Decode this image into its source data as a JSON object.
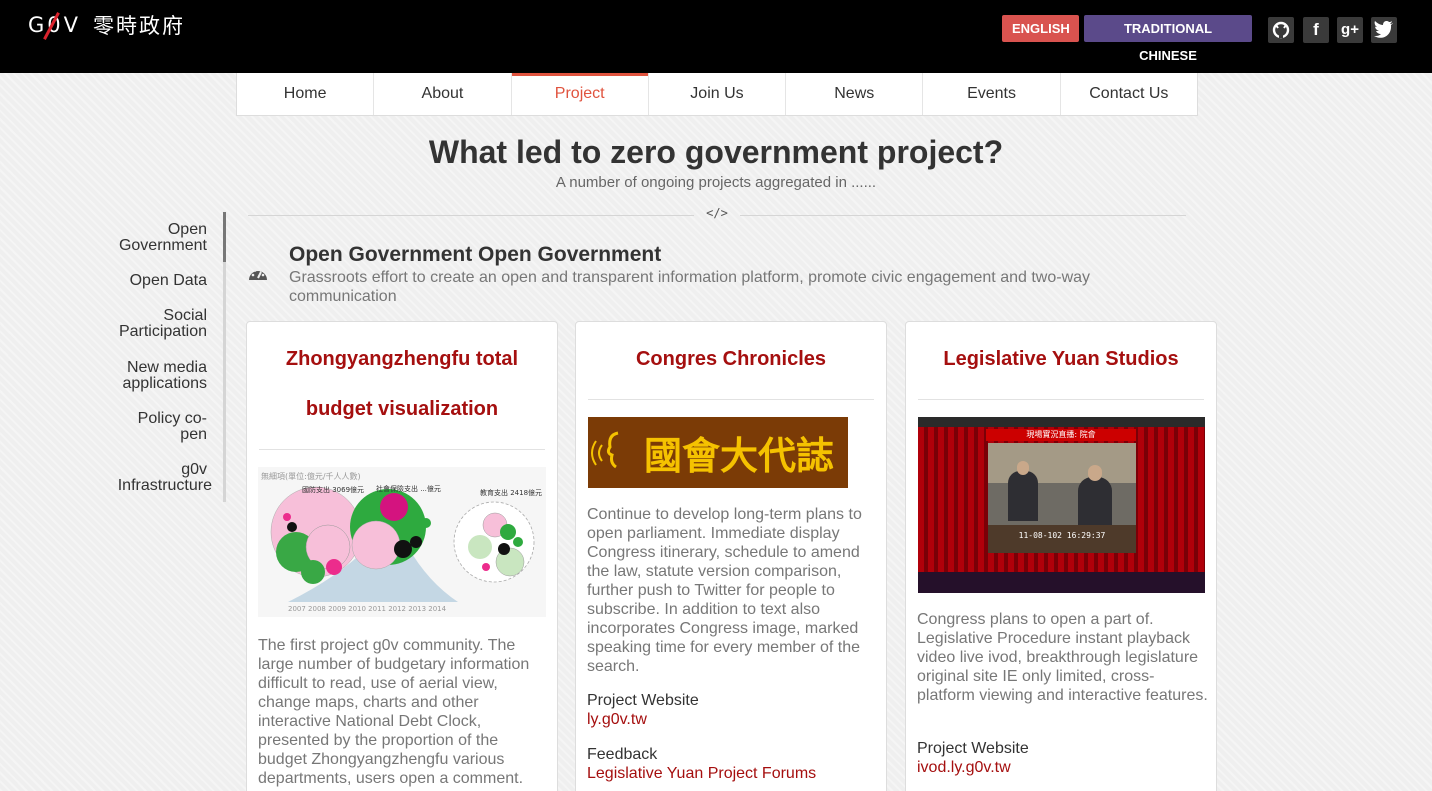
{
  "header": {
    "logo_text": "G0V",
    "logo_cn": "零時政府",
    "lang_en": "ENGLISH",
    "lang_zh": "TRADITIONAL CHINESE",
    "social": [
      "github-icon",
      "facebook-icon",
      "google-plus-icon",
      "twitter-icon"
    ]
  },
  "nav": {
    "items": [
      "Home",
      "About",
      "Project",
      "Join Us",
      "News",
      "Events",
      "Contact Us"
    ],
    "active": "Project"
  },
  "page": {
    "title": "What led to zero government project?",
    "subtitle": "A number of ongoing projects aggregated in ......",
    "divider_glyph": "</>"
  },
  "sidebar": {
    "items": [
      {
        "line1": "Open",
        "line2": "Government"
      },
      {
        "line1": "Open Data",
        "line2": ""
      },
      {
        "line1": "Social",
        "line2": "Participation"
      },
      {
        "line1": "New media",
        "line2": "applications"
      },
      {
        "line1": "Policy co-",
        "line2": "pen"
      },
      {
        "line1": "g0v",
        "line2": "Infrastructure"
      }
    ]
  },
  "section": {
    "title": "Open Government Open Government",
    "description": "Grassroots effort to create an open and transparent information platform, promote civic engagement and two-way communication",
    "icon": "dashboard-icon"
  },
  "cards": [
    {
      "title_line1": "Zhongyangzhengfu total",
      "title_line2": "budget visualization",
      "image_title": "無細項(單位:億元/千人人數)",
      "image_labels": [
        "國防支出 3069億元",
        "社會保險支出 ...億元",
        "教育支出 2418億元"
      ],
      "image_years": "2007 2008 2009 2010 2011 2012 2013 2014",
      "text": "The first project g0v community. The large number of budgetary information difficult to read, use of aerial view, change maps, charts and other interactive National Debt Clock, presented by the proportion of the budget Zhongyangzhengfu various departments, users open a comment."
    },
    {
      "title": "Congres Chronicles",
      "banner_text": "國會大代誌",
      "text": "Continue to develop long-term plans to open parliament. Immediate display Congress itinerary, schedule to amend the law, statute version comparison, further push to Twitter for people to subscribe. In addition to text also incorporates Congress image, marked speaking time for every member of the search.",
      "website_label": "Project Website",
      "website_link": "ly.g0v.tw",
      "feedback_label": "Feedback",
      "feedback_link": "Legislative Yuan Project Forums"
    },
    {
      "title": "Legislative Yuan Studios",
      "video_banner": "現場實況直播: 院會",
      "video_time": "11-08-102  16:29:37",
      "text": "Congress plans to open a part of. Legislative Procedure instant playback video live ivod, breakthrough legislature original site IE only limited, cross-platform viewing and interactive features.",
      "website_label": "Project Website",
      "website_link": "ivod.ly.g0v.tw"
    }
  ],
  "colors": {
    "accent": "#a50f0f",
    "nav_active": "#e0533e",
    "lang_en": "#d9534f",
    "lang_zh": "#5b4a8a"
  }
}
